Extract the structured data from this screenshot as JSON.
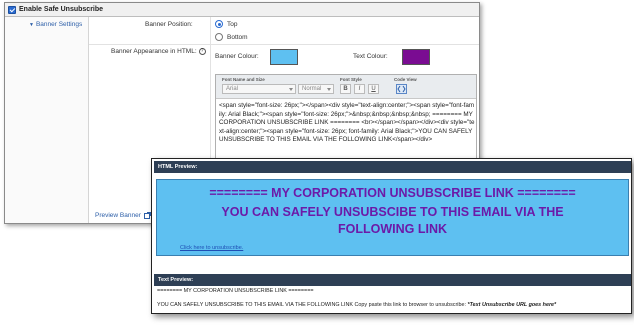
{
  "enable": {
    "label": "Enable Safe Unsubscribe",
    "checked": true
  },
  "sidebar": {
    "item": "Banner Settings"
  },
  "position": {
    "label": "Banner Position:",
    "options": [
      "Top",
      "Bottom"
    ],
    "selected": "Top"
  },
  "appearance": {
    "label": "Banner Appearance in HTML:"
  },
  "colours": {
    "banner_label": "Banner Colour:",
    "banner_value": "#5ec0f1",
    "text_label": "Text Colour:",
    "text_value": "#7a0c92"
  },
  "toolbar": {
    "font_label": "Font Name and Size",
    "font_value": "Arial",
    "size_value": "Normal",
    "style_label": "Font Style",
    "bold": "B",
    "italic": "I",
    "underline": "U",
    "code_label": "Code View"
  },
  "editor": {
    "code": "<span style=\"font-size: 26px;\"></span><div style=\"text-align:center;\"><span style=\"font-family: Arial Black;\"><span style=\"font-size: 26px;\">&nbsp;&nbsp;&nbsp;&nbsp; ======== MY CORPORATION UNSUBSCRIBE LINK ======== <br></span></span></div><div style=\"text-align:center;\"><span style=\"font-size: 26px; font-family: Arial Black;\">YOU CAN SAFELY UNSUBSCRIBE TO THIS EMAIL VIA THE FOLLOWING LINK</span></div>"
  },
  "preview_link": "Preview Banner",
  "html_preview": {
    "heading": "HTML Preview:",
    "line1": "======== MY CORPORATION UNSUBSCRIBE LINK ========",
    "line2": "YOU CAN SAFELY UNSUBSCIBE TO THIS EMAIL VIA THE",
    "line3": "FOLLOWING LINK",
    "link": "Click here to unsubscribe."
  },
  "text_preview": {
    "heading": "Text Preview:",
    "line1": "======== MY CORPORATION UNSUBSCRIBE LINK ========",
    "line2": "YOU CAN SAFELY UNSUBSCRIBE TO THIS EMAIL VIA THE FOLLOWING LINK Copy paste this link to browser to unsubscribe:",
    "line2_bold": "*Text Unsubscribe URL goes here*"
  }
}
